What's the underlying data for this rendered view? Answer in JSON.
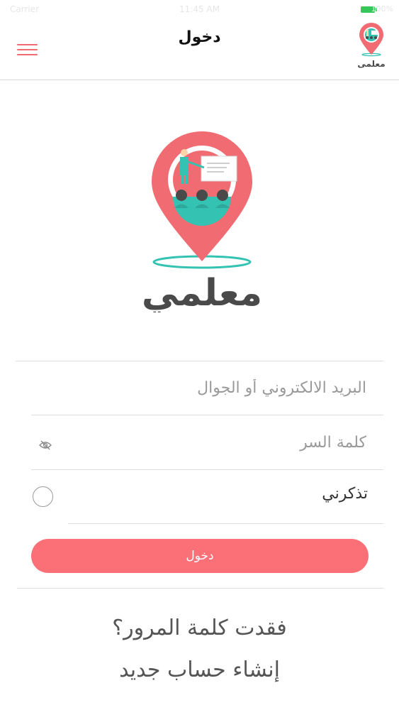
{
  "status_bar": {
    "carrier": "Carrier",
    "time": "11:45 AM",
    "battery_label": "100%"
  },
  "nav": {
    "title": "دخول",
    "logo_text": "معلمي",
    "menu_icon": "hamburger-menu-icon"
  },
  "main_logo": {
    "text": "معلمي"
  },
  "form": {
    "email_placeholder": "البريد الالكتروني أو الجوال",
    "email_value": "",
    "password_placeholder": "كلمة السر",
    "password_value": "",
    "password_toggle_icon": "eye-icon",
    "remember_label": "تذكرني",
    "remember_checked": false,
    "login_label": "دخول"
  },
  "links": {
    "forgot_password": "فقدت كلمة المرور؟",
    "create_account": "إنشاء حساب جديد"
  },
  "colors": {
    "accent": "#fb6f77",
    "logo_pin": "#f06b72",
    "logo_teal": "#34c3b3",
    "logo_text": "#4a4a4a"
  }
}
